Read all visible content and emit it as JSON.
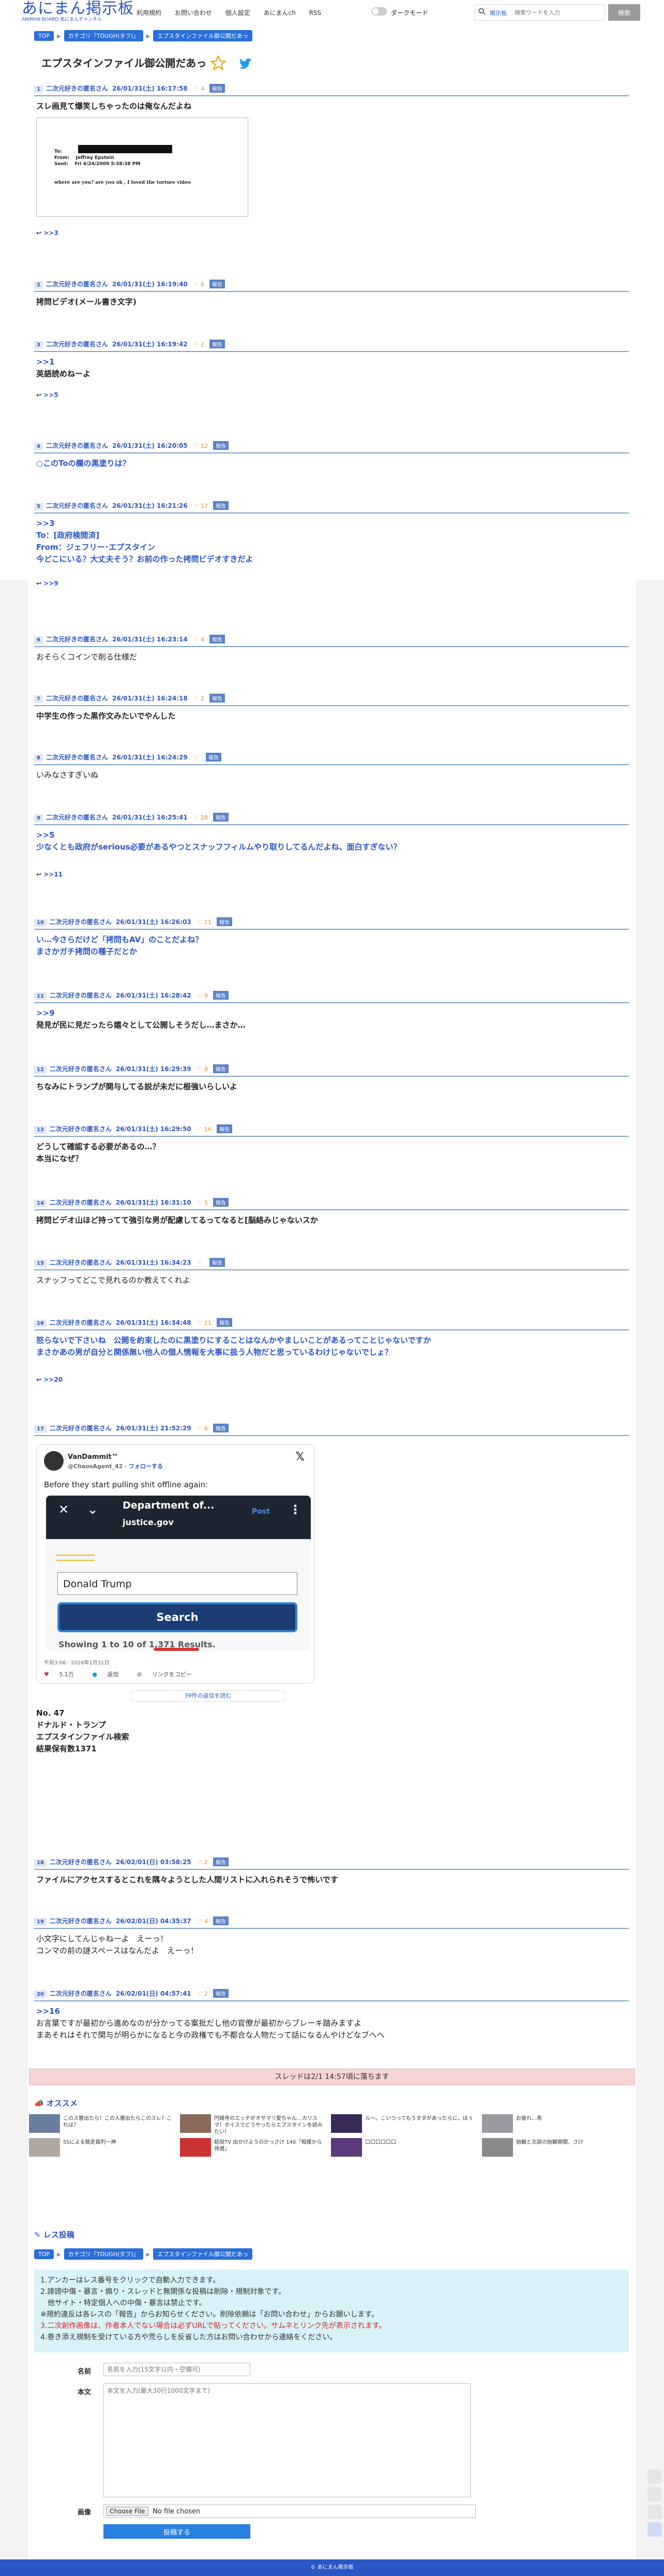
{
  "header": {
    "logo": "あにまん掲示板",
    "logo_sub": "ANIMAN BOARD あにまんチャンネル",
    "nav": [
      "利用規約",
      "お問い合わせ",
      "個人設定",
      "あにまんch",
      "RSS"
    ],
    "dark_mode_label": "ダークモード",
    "search_scope": "掲示板",
    "search_placeholder": "検索ワードを入力",
    "search_button": "検索"
  },
  "breadcrumb": [
    "TOP",
    "カテゴリ「TOUGH(タフ)」",
    "エプスタインファイル御公開だあっ"
  ],
  "thread_title": "エプスタインファイル御公開だあっ",
  "posts": [
    {
      "num": "1",
      "name": "二次元好きの匿名さん",
      "date": "26/01/31(土) 16:17:58",
      "likes": "4",
      "badge": "報告",
      "lines": [
        "スレ画見て爆笑しちゃったのは俺なんだよね"
      ],
      "replies": ">>3"
    },
    {
      "num": "2",
      "name": "二次元好きの匿名さん",
      "date": "26/01/31(土) 16:19:40",
      "likes": "6",
      "badge": "報告",
      "lines": [
        "拷問ビデオ(メール書き文字)"
      ]
    },
    {
      "num": "3",
      "name": "二次元好きの匿名さん",
      "date": "26/01/31(土) 16:19:42",
      "likes": "2",
      "badge": "報告",
      "lines": [
        ">>1",
        "英語読めねーよ"
      ],
      "replies": ">>5"
    },
    {
      "num": "4",
      "name": "二次元好きの匿名さん",
      "date": "26/01/31(土) 16:20:05",
      "likes": "12",
      "badge": "報告",
      "lines": [
        "○このToの欄の黒塗りは？"
      ]
    },
    {
      "num": "5",
      "name": "二次元好きの匿名さん",
      "date": "26/01/31(土) 16:21:26",
      "likes": "17",
      "badge": "報告",
      "lines": [
        ">>3",
        "To：[政府検閲済]",
        "From：ジェフリー･エプスタイン",
        "今どこにいる？大丈夫そう？お前の作った拷問ビデオすきだよ"
      ],
      "replies": ">>9"
    },
    {
      "num": "6",
      "name": "二次元好きの匿名さん",
      "date": "26/01/31(土) 16:23:14",
      "likes": "4",
      "badge": "報告",
      "lines": [
        "おそらくコインで削る仕様だ"
      ]
    },
    {
      "num": "7",
      "name": "二次元好きの匿名さん",
      "date": "26/01/31(土) 16:24:18",
      "likes": "2",
      "badge": "報告",
      "lines": [
        "中学生の作った黒作文みたいでやんした"
      ]
    },
    {
      "num": "8",
      "name": "二次元好きの匿名さん",
      "date": "26/01/31(土) 16:24:29",
      "likes": "",
      "badge": "報告",
      "lines": [
        "いみなさすぎいぬ"
      ]
    },
    {
      "num": "9",
      "name": "二次元好きの匿名さん",
      "date": "26/01/31(土) 16:25:41",
      "likes": "28",
      "badge": "報告",
      "lines": [
        ">>5",
        "少なくとも政府がserious必要があるやつとスナッフフィルムやり取りしてるんだよね、面白すぎない？"
      ],
      "replies": ">>11"
    },
    {
      "num": "10",
      "name": "二次元好きの匿名さん",
      "date": "26/01/31(土) 16:26:03",
      "likes": "11",
      "badge": "報告",
      "lines": [
        "い…今さらだけど「拷問もAV」のことだよね？",
        "まさかガチ拷問の種子だとか"
      ]
    },
    {
      "num": "11",
      "name": "二次元好きの匿名さん",
      "date": "26/01/31(土) 16:28:42",
      "likes": "9",
      "badge": "報告",
      "lines": [
        ">>9",
        "発見が民に見だったら嬉々として公開しそうだし…まさか…"
      ]
    },
    {
      "num": "12",
      "name": "二次元好きの匿名さん",
      "date": "26/01/31(土) 16:29:39",
      "likes": "9",
      "badge": "報告",
      "lines": [
        "ちなみにトランプが関与してる説が未だに根強いらしいよ"
      ]
    },
    {
      "num": "13",
      "name": "二次元好きの匿名さん",
      "date": "26/01/31(土) 16:29:50",
      "likes": "16",
      "badge": "報告",
      "lines": [
        "どうして確認する必要があるの…？",
        "本当になぜ？"
      ]
    },
    {
      "num": "14",
      "name": "二次元好きの匿名さん",
      "date": "26/01/31(土) 16:31:10",
      "likes": "5",
      "badge": "報告",
      "lines": [
        "拷問ビデオ山ほど持ってて強引な男が配慮してるってなると[脳絡みじゃないスか"
      ]
    },
    {
      "num": "15",
      "name": "二次元好きの匿名さん",
      "date": "26/01/31(土) 16:34:23",
      "likes": "",
      "badge": "報告",
      "lines": [
        "スナッフってどこで見れるのか教えてくれよ"
      ]
    },
    {
      "num": "16",
      "name": "二次元好きの匿名さん",
      "date": "26/01/31(土) 16:34:48",
      "likes": "21",
      "badge": "報告",
      "lines": [
        "怒らないで下さいね　公開を約束したのに黒塗りにすることはなんかやましいことがあるってことじゃないですか",
        "まさかあの男が自分と関係無い他人の個人情報を大事に扱う人物だと思っているわけじゃないでしょ？"
      ],
      "replies": ">>20"
    },
    {
      "num": "17",
      "name": "二次元好きの匿名さん",
      "date": "26/01/31(土) 21:52:29",
      "likes": "6",
      "badge": "報告",
      "lines": [
        "No. 47",
        "ドナルド・トランプ",
        "エプスタインファイル検索",
        "結果保有数1371"
      ]
    },
    {
      "num": "18",
      "name": "二次元好きの匿名さん",
      "date": "26/02/01(日) 03:58:25",
      "likes": "2",
      "badge": "報告",
      "lines": [
        "ファイルにアクセスするとこれを隅々ようとした人間リストに入れられそうで怖いです"
      ]
    },
    {
      "num": "19",
      "name": "二次元好きの匿名さん",
      "date": "26/02/01(日) 04:35:37",
      "likes": "4",
      "badge": "報告",
      "lines": [
        "小文字にしてんじゃねーよ　えーっ！",
        "コンマの前の謎スペースはなんだよ　えーっ！"
      ]
    },
    {
      "num": "20",
      "name": "二次元好きの匿名さん",
      "date": "26/02/01(日) 04:57:41",
      "likes": "2",
      "badge": "報告",
      "lines": [
        ">>16",
        "お言葉ですが最初から進めなのが分かってる案批だし他の官僚が最初からブレーキ踏みますよ",
        "まあそれはそれで関与が明らかになると今の政権でも不都合な人物だって話になるんやけどなブへへ"
      ]
    }
  ],
  "email": {
    "from_label": "From:",
    "from_value": "Jeffrey Epstein",
    "sent_label": "Sent:",
    "sent_value": "Fri 4/24/2009 5:38:38 PM",
    "to_label": "To:",
    "body": "where are you? are you ok , I loved the torture video"
  },
  "tweet": {
    "name": "VanDammit™",
    "handle": "@ChaosAgent_42",
    "follow": "フォローする",
    "text": "Before they start pulling shit offline again:",
    "shot_title": "Department of...",
    "shot_domain": "justice.gov",
    "shot_post": "Post",
    "shot_input": "Donald Trump",
    "shot_search": "Search",
    "shot_results": "Showing 1 to 10 of 1,371 Results.",
    "time": "午前3:06 · 2026年1月31日",
    "likes": "5.1万",
    "reply": "返信",
    "copy": "リンクをコピー",
    "more": "39件の返信を読む"
  },
  "thread_status": "スレッドは2/1 14:57頃に落ちます",
  "recommend_title": "オススメ",
  "recommends": [
    "このス層出たら！この人層出たらこのスレ？これは？",
    "円城寺のエッチがオサマリ愛ちゃん…カリスマ！ボイスでどうやったらエプスタインを読みたい！",
    "ル～。こいつってもうタダがあったらに。ほぅ",
    "お疲れ…寿",
    "SSによる競走裁判一神",
    "結局TV 出かけようのかっさけ 140「相撲から待遇」",
    "口口口口口口",
    "始観と北部の始観期間、さけ"
  ],
  "form": {
    "title": "レス投稿",
    "breadcrumb": [
      "TOP",
      "カテゴリ「TOUGH(タフ)」",
      "エプスタインファイル御公開だあっ"
    ],
    "notice": [
      "1.アンカーはレス番号をクリックで自動入力できます。",
      "2.誹謗中傷・暴言・煽り・スレッドと無関係な投稿は削除・規制対象です。",
      "　他サイト・特定個人への中傷・暴言は禁止です。",
      "※規約違反は各レスの「報告」からお知らせください。削除依頼は「お問い合わせ」からお願いします。",
      "3.二次創作画像は、作者本人でない場合は必ずURLで貼ってください。サムネとリンク先が表示されます。",
      "4.巻き添え規制を受けている方や荒らしを反省した方はお問い合わせから連絡をください。"
    ],
    "name_label": "名前",
    "name_placeholder": "名前を入力(15文字以内・空欄可)",
    "body_label": "本文",
    "body_placeholder": "本文を入力(最大30行1000文字まで)",
    "image_label": "画像",
    "choose_file": "Choose File",
    "no_file": "No file chosen",
    "submit": "投稿する"
  },
  "footer": "© あにまん掲示板"
}
